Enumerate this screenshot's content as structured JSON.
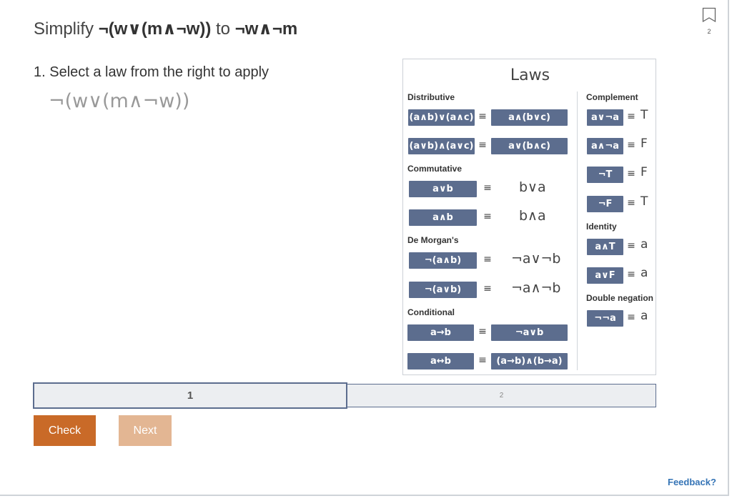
{
  "header": {
    "prefix": "Simplify",
    "from_expr": "¬(w∨(m∧¬w))",
    "connector": "to",
    "to_expr": "¬w∧¬m",
    "bookmark_count": "2"
  },
  "step": {
    "instruction": "1. Select a law from the right to apply",
    "expression": "¬(w∨(m∧¬w))"
  },
  "laws": {
    "title": "Laws",
    "equiv": "≡",
    "distributive": {
      "label": "Distributive",
      "rows": [
        {
          "left": "(a∧b)∨(a∧c)",
          "right": "a∧(b∨c)"
        },
        {
          "left": "(a∨b)∧(a∨c)",
          "right": "a∨(b∧c)"
        }
      ]
    },
    "commutative": {
      "label": "Commutative",
      "rows": [
        {
          "left": "a∨b",
          "right": "b∨a"
        },
        {
          "left": "a∧b",
          "right": "b∧a"
        }
      ]
    },
    "demorgans": {
      "label": "De Morgan's",
      "rows": [
        {
          "left": "¬(a∧b)",
          "right": "¬a∨¬b"
        },
        {
          "left": "¬(a∨b)",
          "right": "¬a∧¬b"
        }
      ]
    },
    "conditional": {
      "label": "Conditional",
      "rows": [
        {
          "left": "a→b",
          "right": "¬a∨b"
        },
        {
          "left": "a↔b",
          "right": "(a→b)∧(b→a)"
        }
      ]
    },
    "complement": {
      "label": "Complement",
      "rows": [
        {
          "left": "a∨¬a",
          "right": "T"
        },
        {
          "left": "a∧¬a",
          "right": "F"
        },
        {
          "left": "¬T",
          "right": "F"
        },
        {
          "left": "¬F",
          "right": "T"
        }
      ]
    },
    "identity": {
      "label": "Identity",
      "rows": [
        {
          "left": "a∧T",
          "right": "a"
        },
        {
          "left": "a∨F",
          "right": "a"
        }
      ]
    },
    "double_negation": {
      "label": "Double negation",
      "rows": [
        {
          "left": "¬¬a",
          "right": "a"
        }
      ]
    }
  },
  "progress": {
    "tab1": "1",
    "tab2": "2"
  },
  "buttons": {
    "check": "Check",
    "next": "Next"
  },
  "feedback": "Feedback?",
  "colors": {
    "chip": "#5c6d8e",
    "check": "#c96a28",
    "next_disabled": "#e3b693",
    "link": "#3574b6"
  }
}
